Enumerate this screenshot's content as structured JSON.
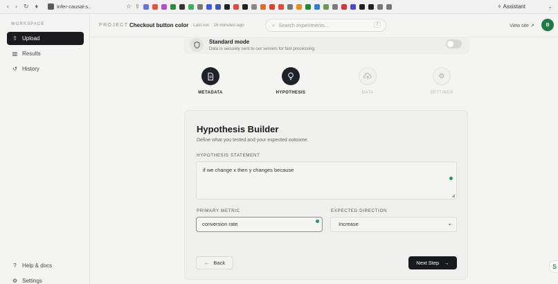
{
  "browser": {
    "tab_title": "infer-causal-s..",
    "assistant_label": "Assistant",
    "extension_colors": [
      "#6b74d6",
      "#e0533f",
      "#b04fd1",
      "#2a8c3b",
      "#333333",
      "#3fae5a",
      "#777777",
      "#3b5bd9",
      "#3c57b5",
      "#222222",
      "#e04a3a",
      "#222222",
      "#888888",
      "#e06a2c",
      "#d8442f",
      "#e14b39",
      "#777777",
      "#f08a1c",
      "#1e8a3a",
      "#2f7fd6",
      "#6a9a54",
      "#7c7c7c",
      "#d6353a",
      "#4a4ad1",
      "#222222",
      "#222222",
      "#777777",
      "#777777"
    ]
  },
  "sidebar": {
    "workspace_label": "WORKSPACE",
    "items": [
      {
        "label": "Upload",
        "icon": "upload-icon"
      },
      {
        "label": "Results",
        "icon": "bar-chart-icon"
      },
      {
        "label": "History",
        "icon": "history-icon"
      }
    ],
    "footer": [
      {
        "label": "Help & docs",
        "icon": "help-icon"
      },
      {
        "label": "Settings",
        "icon": "gear-icon"
      }
    ]
  },
  "topbar": {
    "project_label": "PROJECT",
    "project_name": "Checkout button color",
    "last_run": "Last run · 16 minutes ago",
    "search_placeholder": "Search experiments...",
    "search_shortcut": "/",
    "view_site": "View site",
    "avatar_initial": "B"
  },
  "mode": {
    "title": "Standard mode",
    "description": "Data is securely sent to our servers for fast processing.",
    "enabled": false
  },
  "stepper": [
    {
      "label": "METADATA",
      "state": "done"
    },
    {
      "label": "HYPOTHESIS",
      "state": "done"
    },
    {
      "label": "DATA",
      "state": "todo"
    },
    {
      "label": "SETTINGS",
      "state": "todo"
    }
  ],
  "builder": {
    "title": "Hypothesis Builder",
    "subtitle": "Define what you tested and your expected outcome.",
    "statement_label": "HYPOTHESIS STATEMENT",
    "statement_value": "if we change x then y changes because",
    "metric_label": "PRIMARY METRIC",
    "metric_value": "conversion rate",
    "direction_label": "EXPECTED DIRECTION",
    "direction_value": "Increase",
    "back_label": "Back",
    "next_label": "Next Step"
  },
  "colors": {
    "accent_dark": "#1b1b1f",
    "status_green": "#1e9b5a"
  }
}
